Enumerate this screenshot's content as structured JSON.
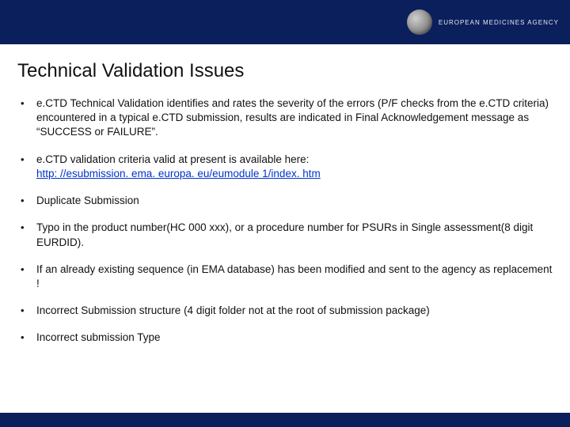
{
  "header": {
    "agency_label": "EUROPEAN MEDICINES AGENCY"
  },
  "title": "Technical Validation Issues",
  "bullets": [
    {
      "text": "e.CTD Technical Validation identifies and rates the severity of the errors (P/F checks from the e.CTD criteria) encountered in a typical e.CTD submission, results are indicated in Final Acknowledgement message as “SUCCESS or FAILURE”."
    },
    {
      "text": "e.CTD validation criteria valid at present is available here:",
      "link_text": "http: //esubmission. ema. europa. eu/eumodule 1/index. htm"
    },
    {
      "text": "Duplicate Submission"
    },
    {
      "text": "Typo in the product number(HC 000 xxx), or a procedure number for PSURs in Single assessment(8 digit EURDID)."
    },
    {
      "text": "If an already existing sequence (in EMA database) has been modified and sent to the agency as replacement !"
    },
    {
      "text": "Incorrect Submission structure (4 digit folder not at the root of submission package)"
    },
    {
      "text": "Incorrect submission Type"
    }
  ]
}
